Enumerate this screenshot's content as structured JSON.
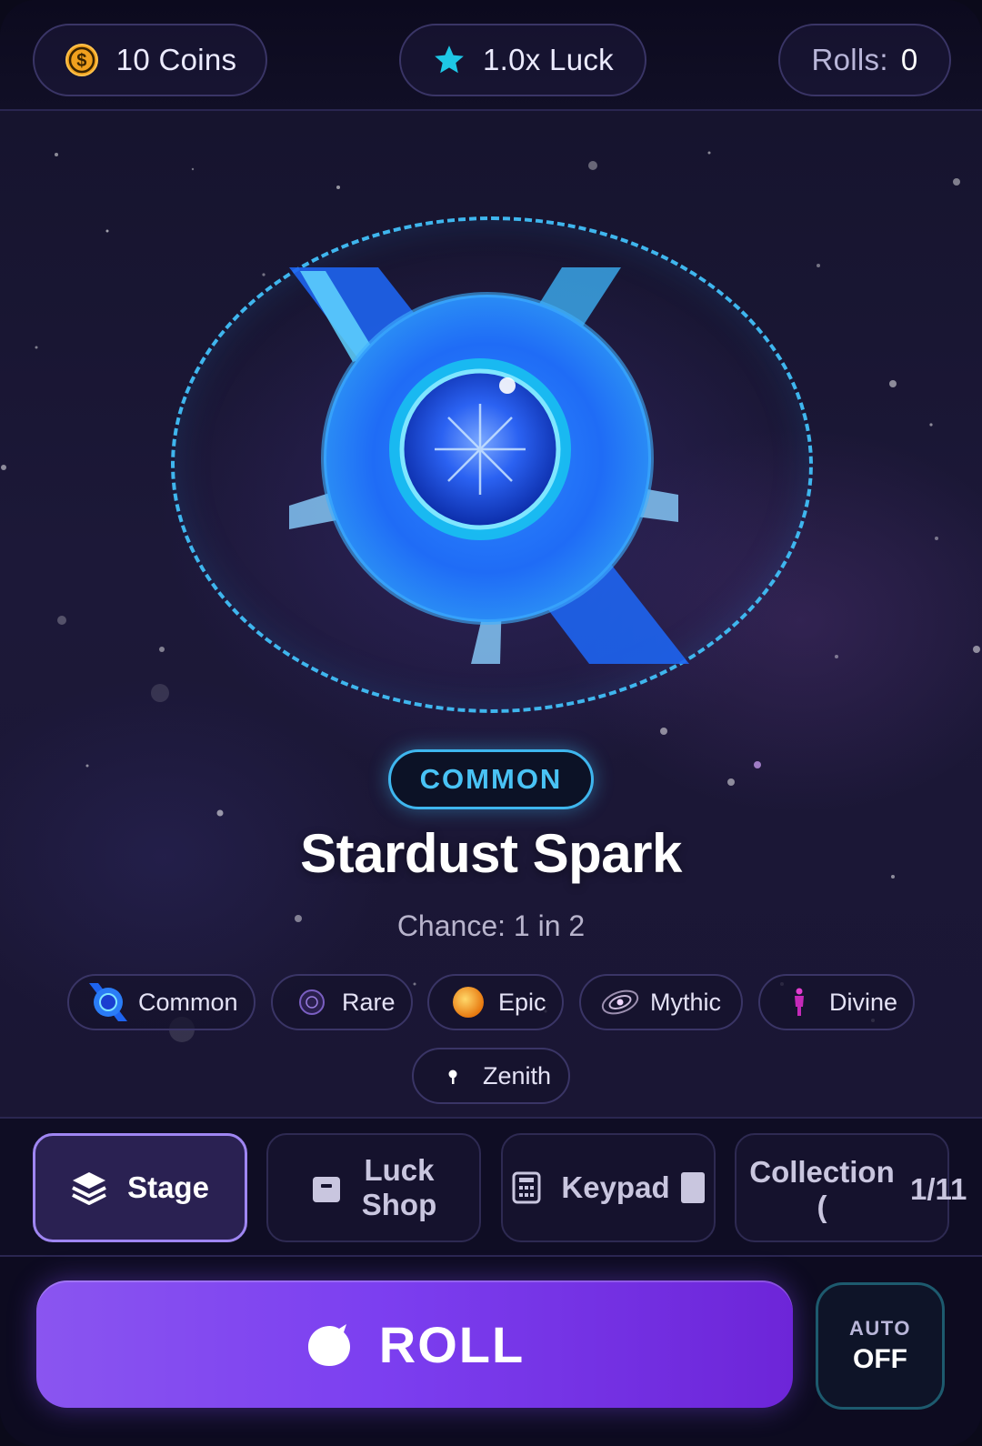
{
  "header": {
    "coins_label": "10 Coins",
    "luck_label": "1.0x Luck",
    "rolls_label": "Rolls:",
    "rolls_value": "0"
  },
  "current_item": {
    "rarity": "COMMON",
    "name": "Stardust Spark",
    "chance_prefix": "Chance:",
    "chance_value": "1 in 2",
    "rarity_color": "#3fb6ee"
  },
  "tiers": [
    {
      "label": "Common",
      "icon": "stardust-spark-icon"
    },
    {
      "label": "Rare",
      "icon": "purple-orb-icon"
    },
    {
      "label": "Epic",
      "icon": "orange-sun-icon"
    },
    {
      "label": "Mythic",
      "icon": "galaxy-icon"
    },
    {
      "label": "Divine",
      "icon": "pink-figure-icon"
    },
    {
      "label": "Zenith",
      "icon": "white-spark-icon"
    }
  ],
  "nav": {
    "stage_label": "Stage",
    "luck_shop_label_1": "Luck",
    "luck_shop_label_2": "Shop",
    "keypad_label": "Keypad",
    "collection_label_1": "Collection",
    "collection_label_2": "(",
    "collection_count": "1/11"
  },
  "actions": {
    "roll_label": "ROLL",
    "auto_label": "AUTO",
    "auto_state": "OFF"
  },
  "colors": {
    "accent_purple": "#7c3ff0",
    "accent_cyan": "#3fb6ee",
    "coin_orange": "#f0a01e"
  }
}
